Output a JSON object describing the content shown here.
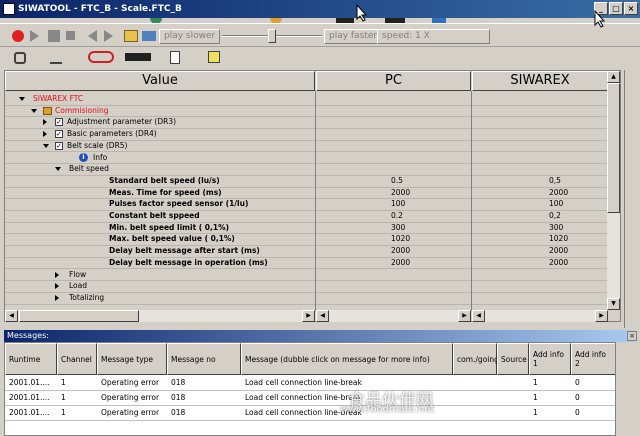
{
  "window": {
    "title": "SIWATOOL - FTC_B - Scale.FTC_B",
    "controls": [
      "_",
      "□",
      "×"
    ]
  },
  "toolbar1": {
    "play_slower": "play slower",
    "play_faster": "play faster",
    "speed": "speed: 1 X"
  },
  "grid": {
    "headers": [
      "Value",
      "PC",
      "SIWAREX"
    ],
    "rows": [
      {
        "label": "SIWAREX FTC",
        "pc": "",
        "sw": ""
      },
      {
        "label": "Commisioning",
        "pc": "",
        "sw": ""
      },
      {
        "label": "Adjustment parameter (DR3)",
        "pc": "",
        "sw": ""
      },
      {
        "label": "Basic parameters (DR4)",
        "pc": "",
        "sw": ""
      },
      {
        "label": "Belt scale (DR5)",
        "pc": "",
        "sw": ""
      },
      {
        "label": "Info",
        "pc": "",
        "sw": ""
      },
      {
        "label": "Belt speed",
        "pc": "",
        "sw": ""
      },
      {
        "label": "Standard belt speed (lu/s)",
        "pc": "0.5",
        "sw": "0,5"
      },
      {
        "label": "Meas. Time for speed (ms)",
        "pc": "2000",
        "sw": "2000"
      },
      {
        "label": "Pulses factor speed sensor (1/lu)",
        "pc": "100",
        "sw": "100"
      },
      {
        "label": "Constant belt sppeed",
        "pc": "0.2",
        "sw": "0,2"
      },
      {
        "label": "Min. belt speed limit ( 0,1%)",
        "pc": "300",
        "sw": "300"
      },
      {
        "label": "Max. belt speed value ( 0,1%)",
        "pc": "1020",
        "sw": "1020"
      },
      {
        "label": "Delay belt message after start (ms)",
        "pc": "2000",
        "sw": "2000"
      },
      {
        "label": "Delay belt message in operation (ms)",
        "pc": "2000",
        "sw": "2000"
      },
      {
        "label": "Flow",
        "pc": "",
        "sw": ""
      },
      {
        "label": "Load",
        "pc": "",
        "sw": ""
      },
      {
        "label": "Totalizing",
        "pc": "",
        "sw": ""
      }
    ]
  },
  "messages": {
    "title": "Messages:",
    "headers": [
      "Runtime",
      "Channel",
      "Message type",
      "Message no",
      "Message (dubble click on message for more info)",
      "com./going",
      "Source",
      "Add info 1",
      "Add info 2"
    ],
    "rows": [
      [
        "2001.01....",
        "1",
        "Operating error",
        "018",
        "Load cell connection line-break",
        "",
        "",
        "1",
        "0"
      ],
      [
        "2001.01....",
        "1",
        "Operating error",
        "018",
        "Load cell connection line-break",
        "",
        "",
        "1",
        "0"
      ],
      [
        "2001.01....",
        "1",
        "Operating error",
        "018",
        "Load cell connection line-break",
        "",
        "",
        "1",
        "0"
      ]
    ]
  },
  "watermark": {
    "line1": "食品伙伴网",
    "line2": "www.foodmate.net"
  },
  "colors": {
    "title_bar": "#0a246a",
    "red_text": "#e01010",
    "panel": "#d4d0c8"
  }
}
